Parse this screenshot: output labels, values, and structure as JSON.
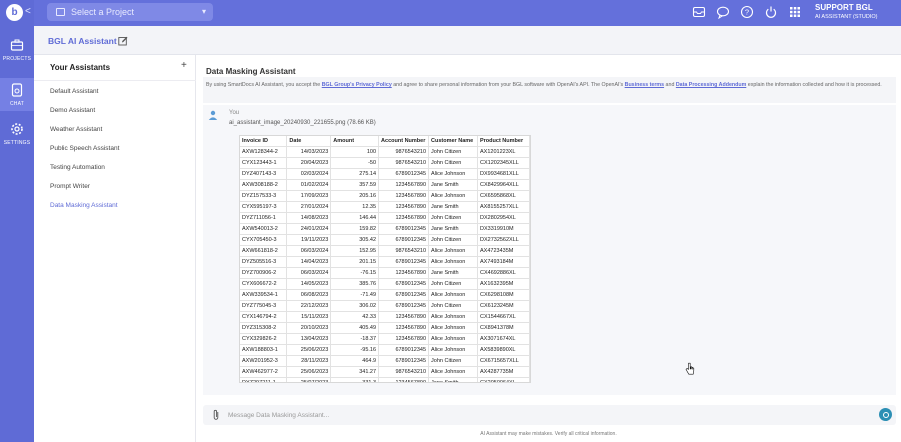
{
  "rail": {
    "logo": "b",
    "collapse": "<",
    "items": [
      {
        "label": "PROJECTS",
        "icon": "briefcase-icon"
      },
      {
        "label": "CHAT",
        "icon": "document-chat-icon"
      },
      {
        "label": "SETTINGS",
        "icon": "gear-icon"
      }
    ]
  },
  "topbar": {
    "project_placeholder": "Select a Project",
    "icons": [
      "inbox-icon",
      "chat-bubble-icon",
      "help-icon",
      "power-icon",
      "apps-grid-icon"
    ],
    "user_name": "SUPPORT BGL",
    "user_role": "AI ASSISTANT (STUDIO)"
  },
  "header": {
    "title": "BGL AI Assistant"
  },
  "assistants": {
    "heading": "Your Assistants",
    "add": "+",
    "items": [
      "Default Assistant",
      "Demo Assistant",
      "Weather Assistant",
      "Public Speech Assistant",
      "Testing Automation",
      "Prompt Writer",
      "Data Masking Assistant"
    ],
    "active": "Data Masking Assistant"
  },
  "main": {
    "title": "Data Masking Assistant",
    "disclaimer": {
      "t1": "By using SmartDocs AI Assistant, you accept the ",
      "link1": "BGL Group's Privacy Policy",
      "t2": " and agree to share personal information from your BGL software with OpenAI's API. The OpenAI's ",
      "link2": "Business terms",
      "t3": " and ",
      "link3": "Data Processing Addendum",
      "t4": " explain the information collected and how it is processed."
    },
    "message": {
      "sender": "You",
      "file": "ai_assistant_image_20240930_221655.png (78.66 KB)"
    },
    "table": {
      "headers": [
        "Invoice ID",
        "Date",
        "Amount",
        "Account Number",
        "Customer Name",
        "Product Number"
      ],
      "rows": [
        [
          "AXW128344-2",
          "14/03/2023",
          "100",
          "9876543210",
          "John Citizen",
          "AX1201223XL"
        ],
        [
          "CYX123443-1",
          "20/04/2023",
          "-50",
          "9876543210",
          "John Citizen",
          "CX1202345XLL"
        ],
        [
          "DYZ407143-3",
          "02/03/2024",
          "275.14",
          "6789012345",
          "Alice Johnson",
          "DX9934681XLL"
        ],
        [
          "AXW308188-2",
          "01/02/2024",
          "357.59",
          "1234567890",
          "Jane Smith",
          "CX8429964XLL"
        ],
        [
          "DYZ157533-3",
          "17/09/2023",
          "205.16",
          "1234567890",
          "Alice Johnson",
          "CX6595868XL"
        ],
        [
          "CYX595197-3",
          "27/01/2024",
          "12.35",
          "1234567890",
          "Jane Smith",
          "AX8155257XLL"
        ],
        [
          "DYZ711056-1",
          "14/08/2023",
          "146.44",
          "1234567890",
          "John Citizen",
          "DX2802954XL"
        ],
        [
          "AXW540013-2",
          "24/01/2024",
          "159.82",
          "6789012345",
          "Jane Smith",
          "DX3319910M"
        ],
        [
          "CYX705450-3",
          "19/11/2023",
          "305.42",
          "6789012345",
          "John Citizen",
          "DX2732562XLL"
        ],
        [
          "AXW661818-2",
          "06/03/2024",
          "152.95",
          "9876543210",
          "Alice Johnson",
          "AX4723435M"
        ],
        [
          "DYZ505516-3",
          "14/04/2023",
          "201.15",
          "6789012345",
          "Alice Johnson",
          "AX7493184M"
        ],
        [
          "DYZ700906-2",
          "06/03/2024",
          "-76.15",
          "1234567890",
          "Jane Smith",
          "CX4692886XL"
        ],
        [
          "CYX606672-2",
          "14/05/2023",
          "385.76",
          "6789012345",
          "John Citizen",
          "AX1632395M"
        ],
        [
          "AXW339534-1",
          "06/08/2023",
          "-71.49",
          "6789012345",
          "Alice Johnson",
          "CX6298108M"
        ],
        [
          "DYZ775045-3",
          "22/12/2023",
          "306.02",
          "6789012345",
          "John Citizen",
          "CX6123245M"
        ],
        [
          "CYX146794-2",
          "15/11/2023",
          "42.33",
          "1234567890",
          "Alice Johnson",
          "CX1544667XL"
        ],
        [
          "DYZ315308-2",
          "20/10/2023",
          "405.49",
          "1234567890",
          "Alice Johnson",
          "CX8941378M"
        ],
        [
          "CYX329826-2",
          "13/04/2023",
          "-18.37",
          "1234567890",
          "Alice Johnson",
          "AX3071674XL"
        ],
        [
          "AXW188803-1",
          "25/06/2023",
          "-95.16",
          "6789012345",
          "Alice Johnson",
          "AX5839890XL"
        ],
        [
          "AXW201952-3",
          "28/11/2023",
          "464.9",
          "6789012345",
          "John Citizen",
          "CX6715657XLL"
        ],
        [
          "AXW462977-2",
          "25/06/2023",
          "341.27",
          "9876543210",
          "Alice Johnson",
          "AX4287735M"
        ],
        [
          "DYZ297211-1",
          "25/07/2023",
          "331.3",
          "1234567890",
          "Jane Smith",
          "CX2050064XL"
        ]
      ]
    },
    "composer": {
      "placeholder": "Message Data Masking Assistant..."
    },
    "footer": "AI Assistant may make mistakes. Verify all critical information."
  }
}
